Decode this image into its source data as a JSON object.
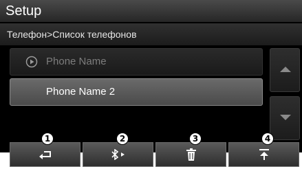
{
  "header": {
    "title": "Setup",
    "breadcrumb": "Телефон>Список телефонов"
  },
  "device_list": {
    "items": [
      {
        "label": "Phone Name",
        "icon": "play-circle-icon",
        "state": "dimmed"
      },
      {
        "label": "Phone Name 2",
        "state": "highlighted"
      }
    ]
  },
  "scroll": {
    "up_icon": "arrow-up-icon",
    "down_icon": "arrow-down-icon"
  },
  "toolbar": {
    "buttons": [
      {
        "icon": "back-icon",
        "callout": "1"
      },
      {
        "icon": "bluetooth-connect-icon",
        "callout": "2"
      },
      {
        "icon": "trash-icon",
        "callout": "3"
      },
      {
        "icon": "move-top-icon",
        "callout": "4"
      }
    ]
  },
  "colors": {
    "background": "#000000",
    "text_primary": "#ffffff",
    "text_dimmed": "#7d7d7d",
    "highlight_row": "#5a5a5a"
  }
}
